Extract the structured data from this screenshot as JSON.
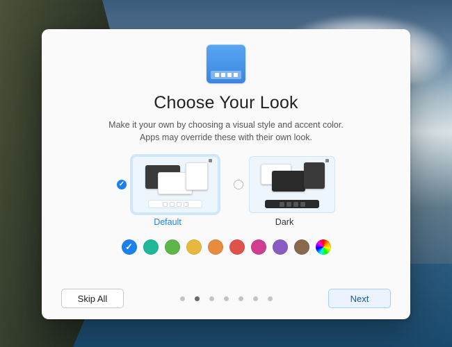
{
  "header": {
    "title": "Choose Your Look",
    "subtitle_line1": "Make it your own by choosing a visual style and accent color.",
    "subtitle_line2": "Apps may override these with their own look."
  },
  "themes": [
    {
      "id": "default",
      "label": "Default",
      "selected": true
    },
    {
      "id": "dark",
      "label": "Dark",
      "selected": false
    }
  ],
  "accent_colors": [
    {
      "name": "blue",
      "hex": "#1a82f0",
      "selected": true
    },
    {
      "name": "teal",
      "hex": "#21b89a",
      "selected": false
    },
    {
      "name": "green",
      "hex": "#5fb648",
      "selected": false
    },
    {
      "name": "yellow",
      "hex": "#e8b93e",
      "selected": false
    },
    {
      "name": "orange",
      "hex": "#e88b3e",
      "selected": false
    },
    {
      "name": "red",
      "hex": "#e0524c",
      "selected": false
    },
    {
      "name": "magenta",
      "hex": "#d23e8e",
      "selected": false
    },
    {
      "name": "purple",
      "hex": "#8a5cc2",
      "selected": false
    },
    {
      "name": "brown",
      "hex": "#8a6a4e",
      "selected": false
    },
    {
      "name": "rainbow",
      "hex": "",
      "selected": false
    }
  ],
  "pager": {
    "total": 7,
    "current_index": 1
  },
  "buttons": {
    "skip_all": "Skip All",
    "next": "Next"
  }
}
